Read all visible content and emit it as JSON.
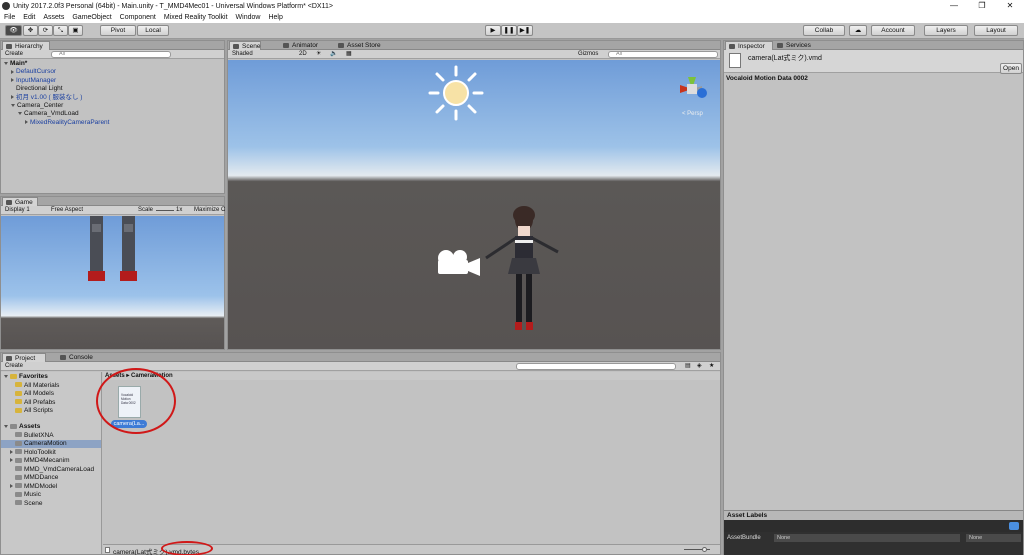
{
  "window": {
    "title": "Unity 2017.2.0f3 Personal (64bit) - Main.unity - T_MMD4Mec01 - Universal Windows Platform* <DX11>"
  },
  "menu": [
    "File",
    "Edit",
    "Assets",
    "GameObject",
    "Component",
    "Mixed Reality Toolkit",
    "Window",
    "Help"
  ],
  "toolbar": {
    "pivot": "Pivot",
    "local": "Local",
    "collab": "Collab",
    "account": "Account",
    "layers": "Layers",
    "layout": "Layout"
  },
  "hierarchy": {
    "tab": "Hierarchy",
    "create": "Create",
    "search": "All",
    "items": [
      {
        "label": "Main*",
        "depth": 0,
        "arrow": "down",
        "blue": false,
        "bold": true
      },
      {
        "label": "DefaultCursor",
        "depth": 1,
        "arrow": "right",
        "blue": true
      },
      {
        "label": "InputManager",
        "depth": 1,
        "arrow": "right",
        "blue": true
      },
      {
        "label": "Directional Light",
        "depth": 1,
        "arrow": "none",
        "blue": false
      },
      {
        "label": "初月 v1.00 ( 服装なし )",
        "depth": 1,
        "arrow": "right",
        "blue": true
      },
      {
        "label": "Camera_Center",
        "depth": 1,
        "arrow": "down",
        "blue": false
      },
      {
        "label": "Camera_VmdLoad",
        "depth": 2,
        "arrow": "down",
        "blue": false
      },
      {
        "label": "MixedRealityCameraParent",
        "depth": 3,
        "arrow": "right",
        "blue": true
      }
    ]
  },
  "scene": {
    "tabs": [
      "Scene",
      "Animator",
      "Asset Store"
    ],
    "shading": "Shaded",
    "mode2d": "2D",
    "gizmos": "Gizmos",
    "search": "All",
    "persp": "< Persp"
  },
  "game": {
    "tab": "Game",
    "display": "Display 1",
    "aspect": "Free Aspect",
    "scale": "Scale",
    "scale_val": "1x",
    "maximize": "Maximize O"
  },
  "inspector": {
    "tabs": [
      "Inspector",
      "Services"
    ],
    "asset_name": "camera(Lat式ミク).vmd",
    "open": "Open",
    "body": "Vocaloid Motion Data 0002",
    "labels": "Asset Labels",
    "bundle": "AssetBundle",
    "bundle_val": "None",
    "variant_val": "None"
  },
  "project": {
    "tabs": [
      "Project",
      "Console"
    ],
    "create": "Create",
    "favorites": {
      "label": "Favorites",
      "items": [
        "All Materials",
        "All Models",
        "All Prefabs",
        "All Scripts"
      ]
    },
    "assets": {
      "label": "Assets",
      "items": [
        {
          "label": "BulletXNA",
          "arrow": "none",
          "selected": false
        },
        {
          "label": "CameraMotion",
          "arrow": "none",
          "selected": true
        },
        {
          "label": "HoloToolkit",
          "arrow": "right",
          "selected": false
        },
        {
          "label": "MMD4Mecanim",
          "arrow": "right",
          "selected": false
        },
        {
          "label": "MMD_VmdCameraLoad",
          "arrow": "none",
          "selected": false
        },
        {
          "label": "MMDDance",
          "arrow": "none",
          "selected": false
        },
        {
          "label": "MMDModel",
          "arrow": "right",
          "selected": false
        },
        {
          "label": "Music",
          "arrow": "none",
          "selected": false
        },
        {
          "label": "Scene",
          "arrow": "none",
          "selected": false
        }
      ]
    },
    "breadcrumb": [
      "Assets",
      "CameraMotion"
    ],
    "file_label": "camera(La...",
    "file_preview": "Vocaloid Motion Data 0002",
    "status_path": "camera(Lat式ミク).vmd.bytes"
  },
  "colors": {
    "panel": "#c2c2c2",
    "sky_top": "#6f9cd8",
    "ground": "#585554",
    "annotation": "#d01818",
    "selection": "#3d7bd6"
  }
}
